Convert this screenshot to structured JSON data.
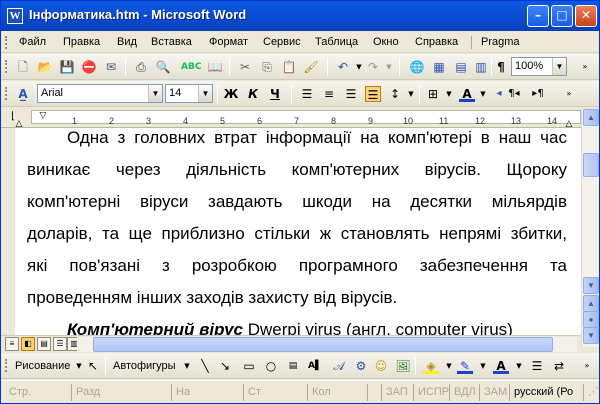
{
  "window": {
    "title": "Інформатика.htm - Microsoft Word",
    "app_icon": "W"
  },
  "title_buttons": {
    "minimize": "–",
    "maximize": "□",
    "close": "✕"
  },
  "menu": {
    "items": [
      "Файл",
      "Правка",
      "Вид",
      "Вставка",
      "Формат",
      "Сервис",
      "Таблица",
      "Окно",
      "Справка",
      "Pragma"
    ]
  },
  "standard_toolbar": {
    "zoom": "100%"
  },
  "formatting_toolbar": {
    "font_name": "Arial",
    "font_size": "14",
    "bold": "Ж",
    "italic": "К",
    "underline": "Ч"
  },
  "ruler": {
    "numbers": [
      "1",
      "2",
      "3",
      "4",
      "5",
      "6",
      "7",
      "8",
      "9",
      "10",
      "11",
      "12",
      "13",
      "14"
    ]
  },
  "document": {
    "paragraph1_lines": [
      "Одна з головних втрат інформації на комп'ютері в наш час",
      "виникає через діяльність комп'ютерних вірусів. Щороку",
      "комп'ютерні віруси завдають шкоди на десятки мільярдів",
      "доларів, та ще приблизно стільки ж становлять непрямі збитки,",
      "які пов'язані з розробкою програмного забезпечення та",
      "проведенням інших заходів захисту від вірусів."
    ],
    "paragraph2_term": "Комп'ютерний вірус",
    "paragraph2_rest": " Dwerpi virus (англ. computer virus)"
  },
  "drawing_toolbar": {
    "draw_label": "Рисование",
    "autoshapes_label": "Автофигуры"
  },
  "status_bar": {
    "page": "Стр.",
    "section": "Разд",
    "at": "На",
    "line": "Ст",
    "column": "Кол",
    "rec": "ЗАП",
    "trk": "ИСПР",
    "ext": "ВДЛ",
    "ovr": "ЗАМ",
    "language": "русский (Ро"
  }
}
